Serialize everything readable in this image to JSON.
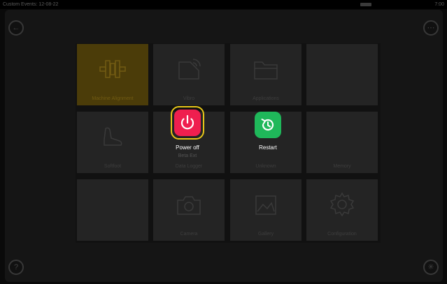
{
  "status": {
    "left_text": "Custom Events: 12-08-22",
    "right_text": "7:00"
  },
  "nav": {
    "back_icon": "back-arrow-icon",
    "help_icon": "help-icon",
    "settings_icon": "tools-icon"
  },
  "tiles": [
    {
      "label": "Machine Alignment",
      "icon": "coupling-icon",
      "active": true
    },
    {
      "label": "Vibro",
      "icon": "sensor-icon"
    },
    {
      "label": "Applications",
      "icon": "folder-icon"
    },
    {
      "label": "",
      "icon": "blank"
    },
    {
      "label": "Softfoot",
      "icon": "softfoot-icon"
    },
    {
      "label": "Data Logger",
      "icon": "blank"
    },
    {
      "label": "Unknown",
      "icon": "blank"
    },
    {
      "label": "Memory",
      "icon": "blank"
    },
    {
      "label": "",
      "icon": "blank"
    },
    {
      "label": "Camera",
      "icon": "camera-icon"
    },
    {
      "label": "Gallery",
      "icon": "gallery-icon"
    },
    {
      "label": "Configuration",
      "icon": "gear-icon"
    }
  ],
  "overlay": {
    "power_off_label": "Power off",
    "restart_label": "Restart",
    "sub_label": "Beta Ext",
    "power_color": "#ef1f4f",
    "restart_color": "#1fb85a",
    "highlight_color": "#e6c619"
  }
}
